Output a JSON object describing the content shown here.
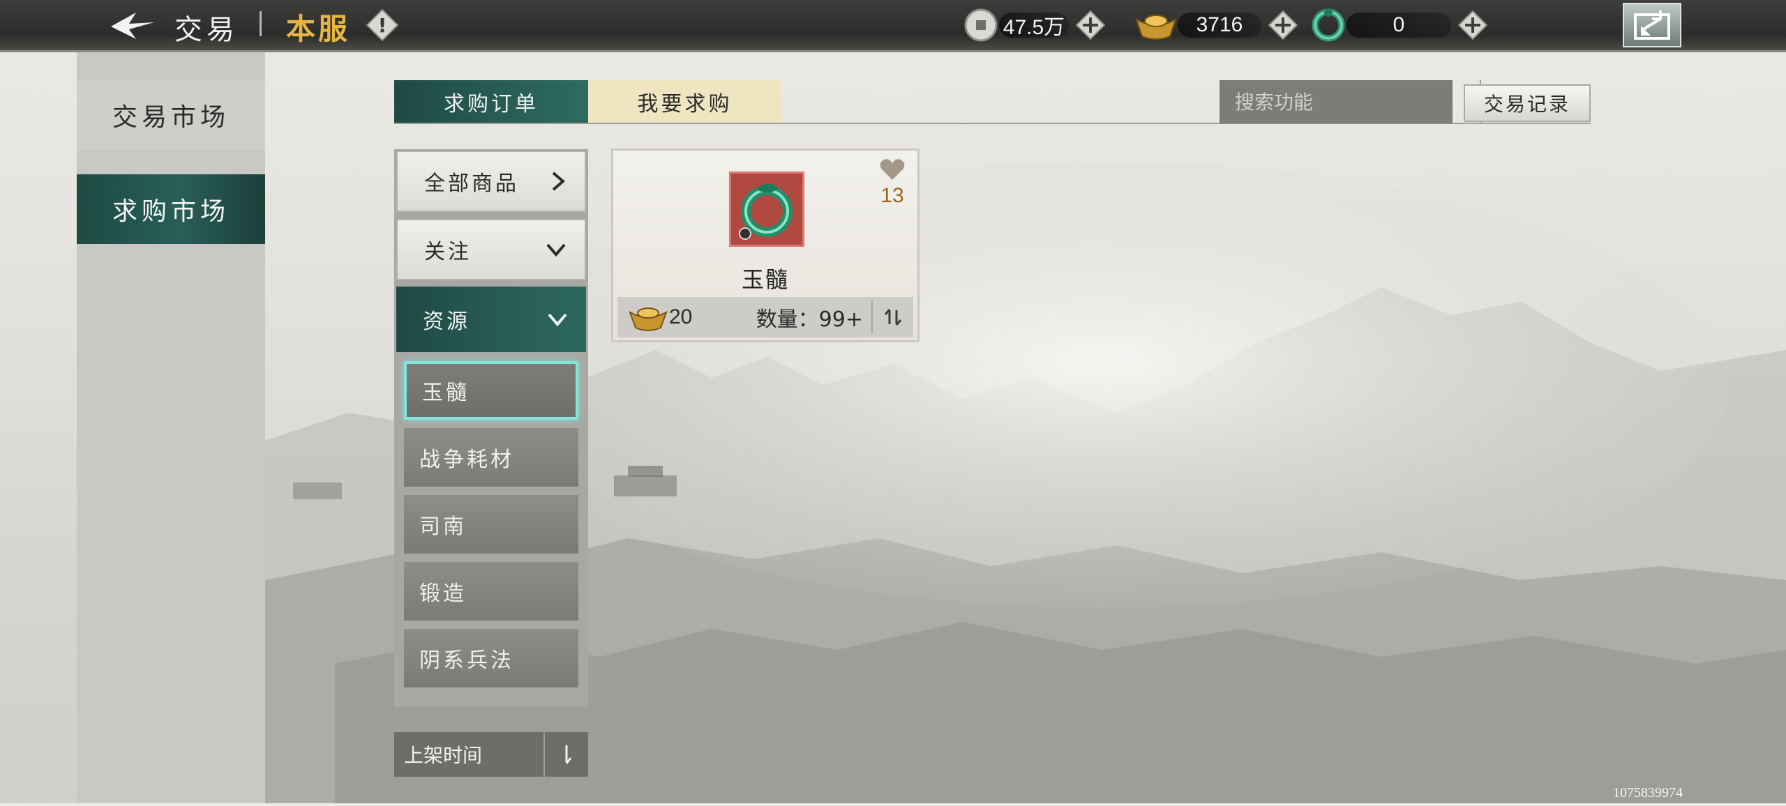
{
  "header": {
    "title": "交易",
    "server": "本服",
    "currencies": [
      {
        "icon": "silver-coin-icon",
        "value": "47.5万"
      },
      {
        "icon": "gold-ingot-icon",
        "value": "3716"
      },
      {
        "icon": "jade-dragon-icon",
        "value": "0"
      }
    ]
  },
  "side_nav": {
    "items": [
      {
        "label": "交易市场",
        "active": false
      },
      {
        "label": "求购市场",
        "active": true
      }
    ]
  },
  "tabs": [
    {
      "label": "求购订单",
      "active": true
    },
    {
      "label": "我要求购",
      "active": false
    }
  ],
  "search": {
    "placeholder": "搜索功能"
  },
  "record_button": "交易记录",
  "categories": {
    "all": "全部商品",
    "follow": "关注",
    "resources": "资源",
    "sub_items": [
      "玉髓",
      "战争耗材",
      "司南",
      "锻造",
      "阴系兵法"
    ]
  },
  "sort": {
    "label": "上架时间"
  },
  "item_card": {
    "name": "玉髓",
    "favorites": "13",
    "price": "20",
    "quantity": "数量：99+"
  },
  "uid": "1075839974",
  "colors": {
    "accent_teal": "#285f57",
    "gold_text": "#e8b640",
    "selection_glow": "#7fe6d9"
  }
}
